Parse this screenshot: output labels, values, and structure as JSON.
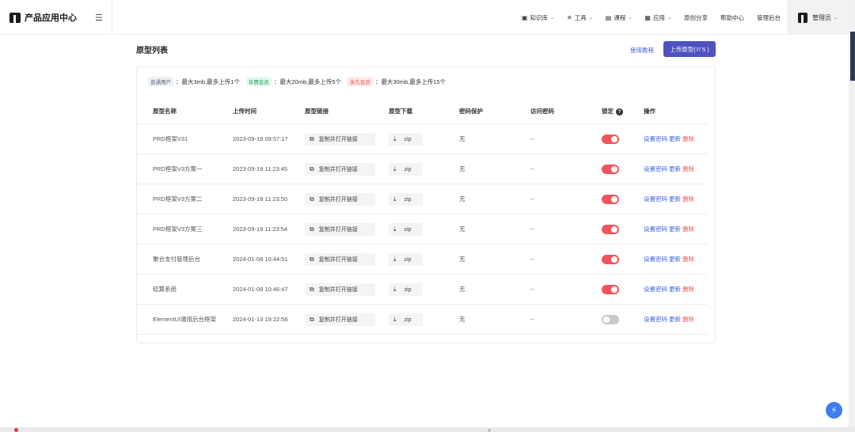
{
  "brand": {
    "name": "产品应用中心"
  },
  "nav": {
    "items": [
      {
        "label": "知识库",
        "icon": "book-icon",
        "glyph": "▣",
        "chevron": true
      },
      {
        "label": "工具",
        "icon": "tools-icon",
        "glyph": "✕",
        "chevron": true
      },
      {
        "label": "课程",
        "icon": "course-icon",
        "glyph": "▤",
        "chevron": true
      },
      {
        "label": "应用",
        "icon": "apps-icon",
        "glyph": "▦",
        "chevron": true
      },
      {
        "label": "原创分享",
        "icon": "",
        "glyph": "",
        "chevron": false
      },
      {
        "label": "帮助中心",
        "icon": "",
        "glyph": "",
        "chevron": false
      },
      {
        "label": "管理后台",
        "icon": "",
        "glyph": "",
        "chevron": false
      }
    ],
    "user": {
      "label": "管理员"
    }
  },
  "page": {
    "title": "原型列表",
    "tutorial_link": "使用教程",
    "upload_button": "上传原型(7/ 5 )"
  },
  "quota": [
    {
      "tag": "普通用户",
      "text": "最大3mb,最多上传1个",
      "color": "gray"
    },
    {
      "tag": "年费会员",
      "text": "最大20mb,最多上传5个",
      "color": "green"
    },
    {
      "tag": "永久会员",
      "text": "最大30mb,最多上传15个",
      "color": "red"
    }
  ],
  "table": {
    "headers": {
      "name": "原型名称",
      "upload_time": "上传时间",
      "link": "原型链接",
      "download": "原型下载",
      "password_protect": "密码保护",
      "access_password": "访问密码",
      "lock": "锁定",
      "actions": "操作"
    },
    "copy_label": "复制并打开链接",
    "zip_label": "zip",
    "op_set_password": "设置密码",
    "op_update": "更新",
    "op_delete": "删除",
    "rows": [
      {
        "name": "PRD框架V31",
        "time": "2023-09-19 09:57:17",
        "protect": "无",
        "password": "--",
        "locked": true
      },
      {
        "name": "PRD框架V3方案一",
        "time": "2023-09-19 11:23:45",
        "protect": "无",
        "password": "--",
        "locked": true
      },
      {
        "name": "PRD框架V3方案二",
        "time": "2023-09-19 11:23:50",
        "protect": "无",
        "password": "--",
        "locked": true
      },
      {
        "name": "PRD框架V3方案三",
        "time": "2023-09-19 11:23:54",
        "protect": "无",
        "password": "--",
        "locked": true
      },
      {
        "name": "聚合支付管理后台",
        "time": "2024-01-08 10:44:51",
        "protect": "无",
        "password": "--",
        "locked": true
      },
      {
        "name": "结算系统",
        "time": "2024-01-08 10:46:47",
        "protect": "无",
        "password": "--",
        "locked": true
      },
      {
        "name": "ElementUI通用后台框架",
        "time": "2024-01-13 19:22:56",
        "protect": "无",
        "password": "--",
        "locked": false
      }
    ]
  },
  "colors": {
    "primary": "#4f51c0",
    "link": "#3d63dd",
    "danger": "#e85656",
    "toggle_on": "#f2545b",
    "toggle_off": "#c8c9cc"
  }
}
